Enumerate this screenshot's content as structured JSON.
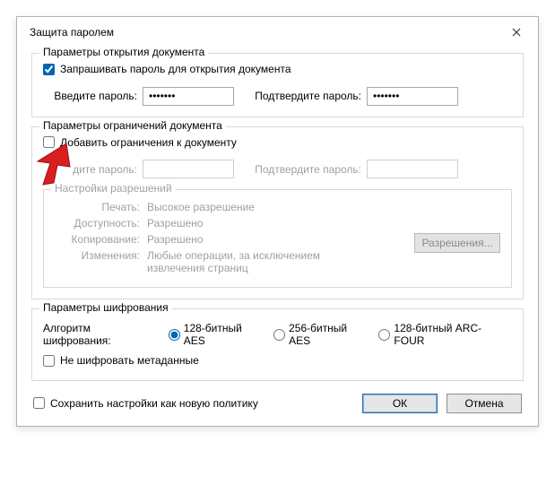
{
  "title": "Защита паролем",
  "open_params": {
    "legend": "Параметры открытия документа",
    "require_pw_label": "Запрашивать пароль для открытия документа",
    "require_pw_checked": true,
    "enter_pw_label": "Введите пароль:",
    "enter_pw_value": "•••••••",
    "confirm_pw_label": "Подтвердите пароль:",
    "confirm_pw_value": "•••••••"
  },
  "restrict_params": {
    "legend": "Параметры ограничений документа",
    "add_restrictions_label": "Добавить ограничения к документу",
    "add_restrictions_checked": false,
    "enter_pw_label": "дите пароль:",
    "confirm_pw_label": "Подтвердите пароль:",
    "perm_legend": "Настройки разрешений",
    "perm": {
      "print_label": "Печать:",
      "print_value": "Высокое разрешение",
      "access_label": "Доступность:",
      "access_value": "Разрешено",
      "copy_label": "Копирование:",
      "copy_value": "Разрешено",
      "changes_label": "Изменения:",
      "changes_value": "Любые операции, за исключением извлечения страниц"
    },
    "perm_button": "Разрешения..."
  },
  "encrypt": {
    "legend": "Параметры шифрования",
    "algo_label": "Алгоритм шифрования:",
    "opt1": "128-битный AES",
    "opt2": "256-битный AES",
    "opt3": "128-битный ARC-FOUR",
    "selected": 1,
    "no_meta_label": "Не шифровать метаданные",
    "no_meta_checked": false
  },
  "footer": {
    "save_policy_label": "Сохранить настройки как новую политику",
    "save_policy_checked": false,
    "ok": "ОК",
    "cancel": "Отмена"
  }
}
